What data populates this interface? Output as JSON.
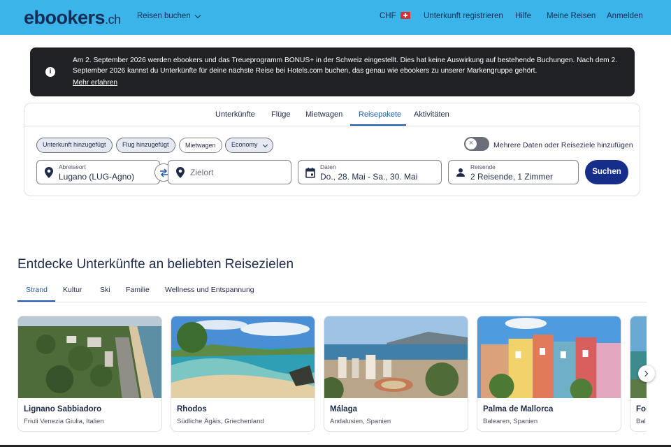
{
  "header": {
    "logo": "ebookers",
    "logo_suffix": ".ch",
    "trips_menu": "Reisen buchen",
    "currency": "CHF",
    "register_property": "Unterkunft registrieren",
    "help": "Hilfe",
    "my_trips": "Meine Reisen",
    "sign_in": "Anmelden"
  },
  "banner": {
    "message": "Am 2. September 2026 werden ebookers und das Treueprogramm BONUS+ in der Schweiz eingestellt. Dies hat keine Auswirkung auf bestehende Buchungen. Nach dem 2. September 2026 kannst du Unterkünfte für deine nächste Reise bei Hotels.com buchen, das genau wie ebookers zu unserer Markengruppe gehört.",
    "link": "Mehr erfahren"
  },
  "search": {
    "tabs": [
      "Unterkünfte",
      "Flüge",
      "Mietwagen",
      "Reisepakete",
      "Aktivitäten"
    ],
    "active_tab": "Reisepakete",
    "chips": {
      "stay": "Unterkunft hinzugefügt",
      "flight": "Flug hinzugefügt",
      "car": "Mietwagen",
      "cabin": "Economy"
    },
    "toggle_label": "Mehrere Daten oder Reiseziele hinzufügen",
    "origin_label": "Abreiseort",
    "origin_value": "Lugano (LUG-Agno)",
    "destination_placeholder": "Zielort",
    "dates_label": "Daten",
    "dates_value": "Do., 28. Mai - Sa., 30. Mai",
    "travelers_label": "Reisende",
    "travelers_value": "2 Reisende, 1 Zimmer",
    "search_button": "Suchen"
  },
  "explore": {
    "title": "Entdecke Unterkünfte an beliebten Reisezielen",
    "tabs": [
      "Strand",
      "Kultur",
      "Ski",
      "Familie",
      "Wellness und Entspannung"
    ],
    "active_tab": "Strand",
    "cards": [
      {
        "name": "Lignano Sabbiadoro",
        "region": "Friuli Venezia Giulia, Italien"
      },
      {
        "name": "Rhodos",
        "region": "Südliche Ägäis, Griechenland"
      },
      {
        "name": "Málaga",
        "region": "Andalusien, Spanien"
      },
      {
        "name": "Palma de Mallorca",
        "region": "Balearen, Spanien"
      },
      {
        "name": "For",
        "region": "Bal"
      }
    ]
  },
  "colors": {
    "header_bg": "#3bb4e9",
    "brand_navy": "#162d57",
    "accent_blue": "#1f5aa8",
    "search_button": "#162d8a",
    "banner_bg": "#202124"
  }
}
